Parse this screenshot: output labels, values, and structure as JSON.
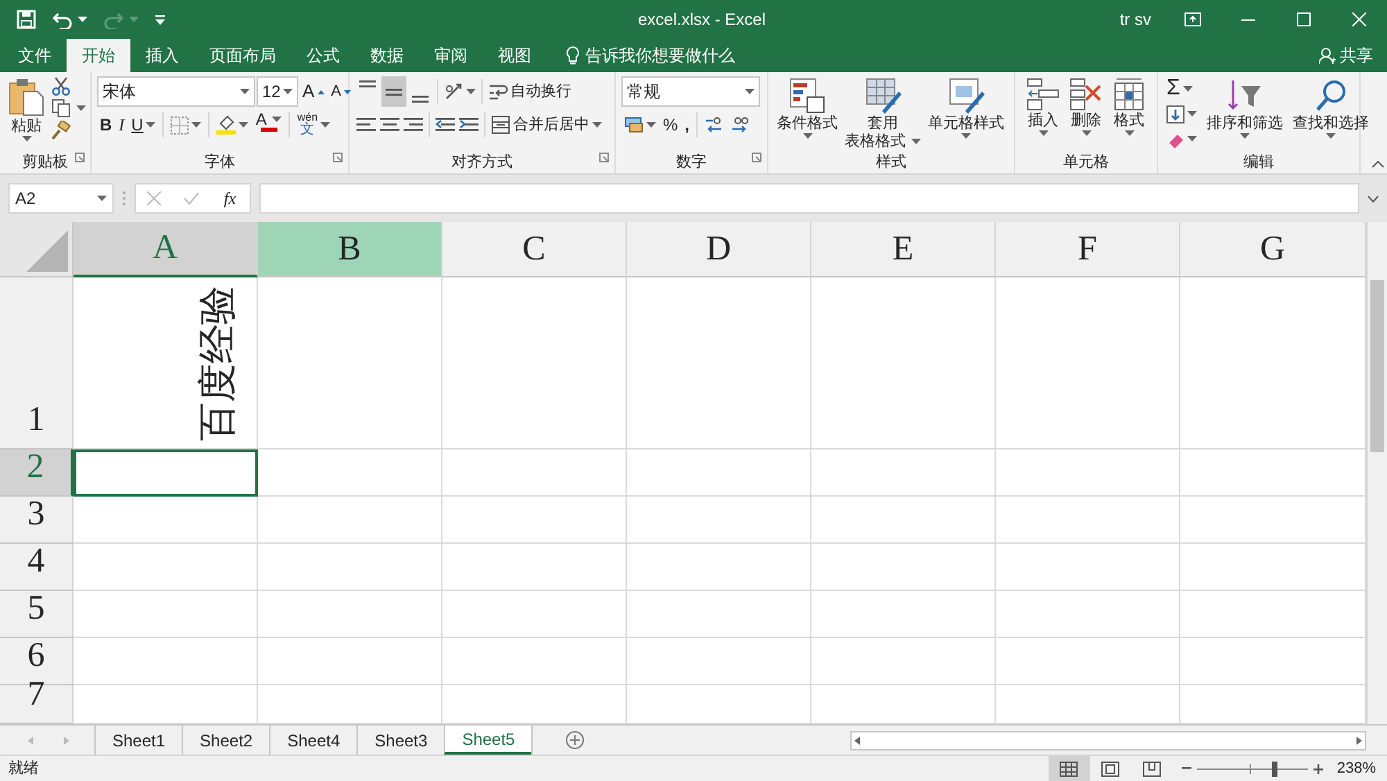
{
  "window": {
    "title": "excel.xlsx  -  Excel",
    "user": "tr sv"
  },
  "tabs": [
    {
      "label": "文件",
      "selected": false
    },
    {
      "label": "开始",
      "selected": true
    },
    {
      "label": "插入",
      "selected": false
    },
    {
      "label": "页面布局",
      "selected": false
    },
    {
      "label": "公式",
      "selected": false
    },
    {
      "label": "数据",
      "selected": false
    },
    {
      "label": "审阅",
      "selected": false
    },
    {
      "label": "视图",
      "selected": false
    }
  ],
  "tell_me": "告诉我你想要做什么",
  "share": "共享",
  "ribbon": {
    "clipboard": {
      "paste": "粘贴",
      "label": "剪贴板"
    },
    "font": {
      "font_name": "宋体",
      "font_size": "12",
      "grow_font": "A",
      "shrink_font": "A",
      "bold": "B",
      "italic": "I",
      "underline": "U",
      "font_color": "A",
      "phonetic_top": "wén",
      "phonetic_bottom": "文",
      "label": "字体"
    },
    "alignment": {
      "vertical_align": [
        {
          "selected": false
        },
        {
          "selected": true
        },
        {
          "selected": false
        }
      ],
      "wrap_text": "自动换行",
      "merge_center": "合并后居中",
      "label": "对齐方式"
    },
    "number": {
      "format": "常规",
      "percent": "%",
      "comma": ",",
      "label": "数字"
    },
    "styles": {
      "buttons": [
        [
          "条件格式"
        ],
        [
          "套用",
          "表格格式"
        ],
        [
          "单元格样式"
        ]
      ],
      "label": "样式"
    },
    "cells": {
      "buttons": [
        "插入",
        "删除",
        "格式"
      ],
      "label": "单元格"
    },
    "editing": {
      "autosum": "Σ",
      "sort_filter": "排序和筛选",
      "find_select": "查找和选择",
      "label": "编辑"
    }
  },
  "formula_bar": {
    "name_box": "A2",
    "function_button": "fx"
  },
  "sheet": {
    "columns": [
      {
        "label": "A",
        "selected": true,
        "highlighted": false
      },
      {
        "label": "B",
        "selected": false,
        "highlighted": true
      },
      {
        "label": "C",
        "selected": false,
        "highlighted": false
      },
      {
        "label": "D",
        "selected": false,
        "highlighted": false
      },
      {
        "label": "E",
        "selected": false,
        "highlighted": false
      },
      {
        "label": "F",
        "selected": false,
        "highlighted": false
      },
      {
        "label": "G",
        "selected": false,
        "highlighted": false
      }
    ],
    "rows": [
      {
        "label": "1",
        "selected": false,
        "cells": [
          {
            "text": "百度经验",
            "rotated": true
          }
        ]
      },
      {
        "label": "2",
        "selected": true
      },
      {
        "label": "3",
        "selected": false
      },
      {
        "label": "4",
        "selected": false
      },
      {
        "label": "5",
        "selected": false
      },
      {
        "label": "6",
        "selected": false
      },
      {
        "label": "7",
        "selected": false
      }
    ]
  },
  "sheet_tabs": [
    {
      "label": "Sheet1",
      "selected": false
    },
    {
      "label": "Sheet2",
      "selected": false
    },
    {
      "label": "Sheet4",
      "selected": false
    },
    {
      "label": "Sheet3",
      "selected": false
    },
    {
      "label": "Sheet5",
      "selected": true
    }
  ],
  "status_bar": {
    "text": "就绪",
    "views": [
      {
        "selected": true
      },
      {
        "selected": false
      },
      {
        "selected": false
      }
    ],
    "zoom": {
      "level": 0.7
    },
    "zoom_text": "238%"
  }
}
